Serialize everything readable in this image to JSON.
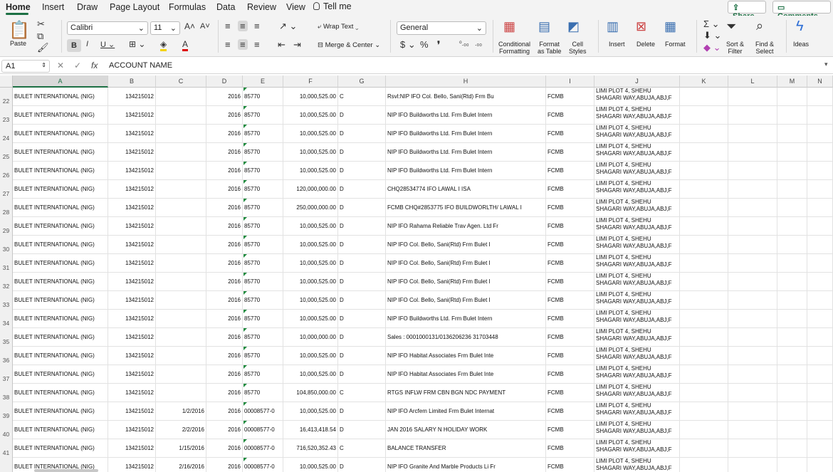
{
  "menu": {
    "tabs": [
      "Home",
      "Insert",
      "Draw",
      "Page Layout",
      "Formulas",
      "Data",
      "Review",
      "View"
    ],
    "tell_me": "Tell me",
    "share": "Share",
    "comments": "Comments"
  },
  "ribbon": {
    "paste": "Paste",
    "font_name": "Calibri",
    "font_size": "11",
    "wrap_text": "Wrap Text",
    "merge_center": "Merge & Center",
    "number_format": "General",
    "conditional_1": "Conditional",
    "conditional_2": "Formatting",
    "format_table_1": "Format",
    "format_table_2": "as Table",
    "cell_styles_1": "Cell",
    "cell_styles_2": "Styles",
    "insert": "Insert",
    "delete": "Delete",
    "format": "Format",
    "sort_1": "Sort &",
    "sort_2": "Filter",
    "find_1": "Find &",
    "find_2": "Select",
    "ideas": "Ideas"
  },
  "formula_bar": {
    "cell_ref": "A1",
    "fx": "fx",
    "content": "ACCOUNT NAME"
  },
  "columns": [
    "A",
    "B",
    "C",
    "D",
    "E",
    "F",
    "G",
    "H",
    "I",
    "J",
    "K",
    "L",
    "M",
    "N"
  ],
  "rows": [
    {
      "n": "22",
      "a": "BULET INTERNATIONAL (NIG)",
      "b": "134215012",
      "c": "",
      "d": "2016",
      "e": "85770",
      "f": "10,000,525.00",
      "g": "C",
      "h": "Rsvl:NIP IFO Col. Bello, Sani(Rtd) Frm Bu",
      "i": "FCMB",
      "j": "LIMI    PLOT 4, SHEHU SHAGARI WAY,ABUJA,ABJ,F"
    },
    {
      "n": "23",
      "a": "BULET INTERNATIONAL (NIG)",
      "b": "134215012",
      "c": "",
      "d": "2016",
      "e": "85770",
      "f": "10,000,525.00",
      "g": "D",
      "h": "NIP IFO Buildworths Ltd. Frm Bulet Intern",
      "i": "FCMB",
      "j": "LIMI    PLOT 4, SHEHU SHAGARI WAY,ABUJA,ABJ,F"
    },
    {
      "n": "24",
      "a": "BULET INTERNATIONAL (NIG)",
      "b": "134215012",
      "c": "",
      "d": "2016",
      "e": "85770",
      "f": "10,000,525.00",
      "g": "D",
      "h": "NIP IFO Buildworths Ltd. Frm Bulet Intern",
      "i": "FCMB",
      "j": "LIMI    PLOT 4, SHEHU SHAGARI WAY,ABUJA,ABJ,F"
    },
    {
      "n": "25",
      "a": "BULET INTERNATIONAL (NIG)",
      "b": "134215012",
      "c": "",
      "d": "2016",
      "e": "85770",
      "f": "10,000,525.00",
      "g": "D",
      "h": "NIP IFO Buildworths Ltd. Frm Bulet Intern",
      "i": "FCMB",
      "j": "LIMI    PLOT 4, SHEHU SHAGARI WAY,ABUJA,ABJ,F"
    },
    {
      "n": "26",
      "a": "BULET INTERNATIONAL (NIG)",
      "b": "134215012",
      "c": "",
      "d": "2016",
      "e": "85770",
      "f": "10,000,525.00",
      "g": "D",
      "h": "NIP IFO Buildworths Ltd. Frm Bulet Intern",
      "i": "FCMB",
      "j": "LIMI    PLOT 4, SHEHU SHAGARI WAY,ABUJA,ABJ,F"
    },
    {
      "n": "27",
      "a": "BULET INTERNATIONAL (NIG)",
      "b": "134215012",
      "c": "",
      "d": "2016",
      "e": "85770",
      "f": "120,000,000.00",
      "g": "D",
      "h": "CHQ28534774 IFO LAWAL I ISA",
      "i": "FCMB",
      "j": "LIMI    PLOT 4, SHEHU SHAGARI WAY,ABUJA,ABJ,F"
    },
    {
      "n": "28",
      "a": "BULET INTERNATIONAL (NIG)",
      "b": "134215012",
      "c": "",
      "d": "2016",
      "e": "85770",
      "f": "250,000,000.00",
      "g": "D",
      "h": "FCMB CHQ#2853775 IFO BUILDWORLTH/ LAWAL I",
      "i": "FCMB",
      "j": "LIMI    PLOT 4, SHEHU SHAGARI WAY,ABUJA,ABJ,F"
    },
    {
      "n": "29",
      "a": "BULET INTERNATIONAL (NIG)",
      "b": "134215012",
      "c": "",
      "d": "2016",
      "e": "85770",
      "f": "10,000,525.00",
      "g": "D",
      "h": "NIP IFO Rahama Reliable Trav Agen. Ltd Fr",
      "i": "FCMB",
      "j": "LIMI    PLOT 4, SHEHU SHAGARI WAY,ABUJA,ABJ,F"
    },
    {
      "n": "30",
      "a": "BULET INTERNATIONAL (NIG)",
      "b": "134215012",
      "c": "",
      "d": "2016",
      "e": "85770",
      "f": "10,000,525.00",
      "g": "D",
      "h": "NIP IFO Col. Bello, Sani(Rtd) Frm Bulet I",
      "i": "FCMB",
      "j": "LIMI    PLOT 4, SHEHU SHAGARI WAY,ABUJA,ABJ,F"
    },
    {
      "n": "31",
      "a": "BULET INTERNATIONAL (NIG)",
      "b": "134215012",
      "c": "",
      "d": "2016",
      "e": "85770",
      "f": "10,000,525.00",
      "g": "D",
      "h": "NIP IFO Col. Bello, Sani(Rtd) Frm Bulet I",
      "i": "FCMB",
      "j": "LIMI    PLOT 4, SHEHU SHAGARI WAY,ABUJA,ABJ,F"
    },
    {
      "n": "32",
      "a": "BULET INTERNATIONAL (NIG)",
      "b": "134215012",
      "c": "",
      "d": "2016",
      "e": "85770",
      "f": "10,000,525.00",
      "g": "D",
      "h": "NIP IFO Col. Bello, Sani(Rtd) Frm Bulet I",
      "i": "FCMB",
      "j": "LIMI    PLOT 4, SHEHU SHAGARI WAY,ABUJA,ABJ,F"
    },
    {
      "n": "33",
      "a": "BULET INTERNATIONAL (NIG)",
      "b": "134215012",
      "c": "",
      "d": "2016",
      "e": "85770",
      "f": "10,000,525.00",
      "g": "D",
      "h": "NIP IFO Col. Bello, Sani(Rtd) Frm Bulet I",
      "i": "FCMB",
      "j": "LIMI    PLOT 4, SHEHU SHAGARI WAY,ABUJA,ABJ,F"
    },
    {
      "n": "34",
      "a": "BULET INTERNATIONAL (NIG)",
      "b": "134215012",
      "c": "",
      "d": "2016",
      "e": "85770",
      "f": "10,000,525.00",
      "g": "D",
      "h": "NIP IFO Buildworths Ltd. Frm Bulet Intern",
      "i": "FCMB",
      "j": "LIMI    PLOT 4, SHEHU SHAGARI WAY,ABUJA,ABJ,F"
    },
    {
      "n": "35",
      "a": "BULET INTERNATIONAL (NIG)",
      "b": "134215012",
      "c": "",
      "d": "2016",
      "e": "85770",
      "f": "10,000,000.00",
      "g": "D",
      "h": "Sales : 0001000131/0136206236  31703448",
      "i": "FCMB",
      "j": "LIMI    PLOT 4, SHEHU SHAGARI WAY,ABUJA,ABJ,F"
    },
    {
      "n": "36",
      "a": "BULET INTERNATIONAL (NIG)",
      "b": "134215012",
      "c": "",
      "d": "2016",
      "e": "85770",
      "f": "10,000,525.00",
      "g": "D",
      "h": "NIP IFO Habitat Associates Frm Bulet Inte",
      "i": "FCMB",
      "j": "LIMI    PLOT 4, SHEHU SHAGARI WAY,ABUJA,ABJ,F"
    },
    {
      "n": "37",
      "a": "BULET INTERNATIONAL (NIG)",
      "b": "134215012",
      "c": "",
      "d": "2016",
      "e": "85770",
      "f": "10,000,525.00",
      "g": "D",
      "h": "NIP IFO Habitat Associates Frm Bulet Inte",
      "i": "FCMB",
      "j": "LIMI    PLOT 4, SHEHU SHAGARI WAY,ABUJA,ABJ,F"
    },
    {
      "n": "38",
      "a": "BULET INTERNATIONAL (NIG)",
      "b": "134215012",
      "c": "",
      "d": "2016",
      "e": "85770",
      "f": "104,850,000.00",
      "g": "C",
      "h": "RTGS INFLW FRM CBN BGN NDC PAYMENT",
      "i": "FCMB",
      "j": "LIMI    PLOT 4, SHEHU SHAGARI WAY,ABUJA,ABJ,F"
    },
    {
      "n": "39",
      "a": "BULET INTERNATIONAL (NIG)",
      "b": "134215012",
      "c": "1/2/2016",
      "d": "2016",
      "e": "00008577-0",
      "f": "10,000,525.00",
      "g": "D",
      "h": "NIP IFO Arcfem Limited Frm Bulet Internat",
      "i": "FCMB",
      "j": "LIMI    PLOT 4, SHEHU SHAGARI WAY,ABUJA,ABJ,F"
    },
    {
      "n": "40",
      "a": "BULET INTERNATIONAL (NIG)",
      "b": "134215012",
      "c": "2/2/2016",
      "d": "2016",
      "e": "00008577-0",
      "f": "16,413,418.54",
      "g": "D",
      "h": "JAN 2016 SALARY N HOLIDAY WORK",
      "i": "FCMB",
      "j": "LIMI    PLOT 4, SHEHU SHAGARI WAY,ABUJA,ABJ,F"
    },
    {
      "n": "41",
      "a": "BULET INTERNATIONAL (NIG)",
      "b": "134215012",
      "c": "1/15/2016",
      "d": "2016",
      "e": "00008577-0",
      "f": "716,520,352.43",
      "g": "C",
      "h": "BALANCE TRANSFER",
      "i": "FCMB",
      "j": "LIMI    PLOT 4, SHEHU SHAGARI WAY,ABUJA,ABJ,F"
    },
    {
      "n": "",
      "a": "BULET INTERNATIONAL (NIG)",
      "b": "134215012",
      "c": "2/16/2016",
      "d": "2016",
      "e": "00008577-0",
      "f": "10,000,525.00",
      "g": "D",
      "h": "NIP IFO Granite And Marble Products Li Fr",
      "i": "FCMB",
      "j": "LIMI    PLOT 4, SHEHU SHAGARI WAY,ABUJA,ABJ,F"
    }
  ]
}
